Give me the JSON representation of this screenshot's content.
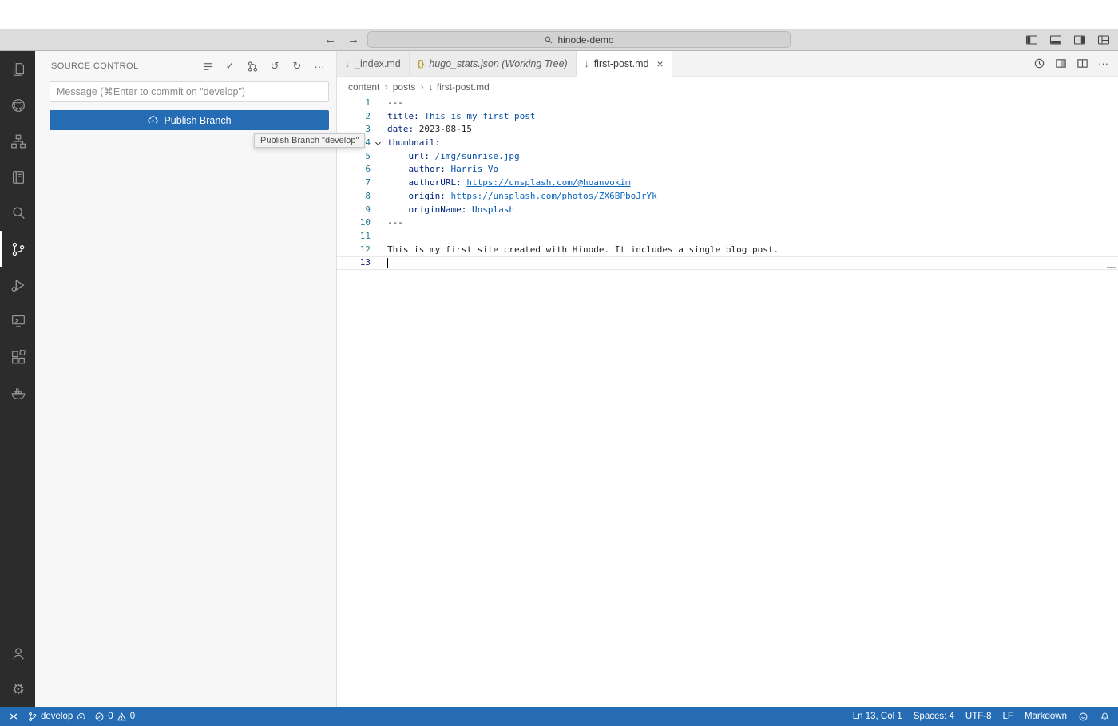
{
  "title_bar": {
    "search_value": "hinode-demo"
  },
  "icons": {
    "back": "←",
    "forward": "→",
    "check": "✓",
    "history": "↺",
    "refresh": "↻",
    "more": "···",
    "gear": "⚙",
    "markdown": "↓",
    "json": "{}",
    "close": "×",
    "sep": "›"
  },
  "sidebar": {
    "title": "SOURCE CONTROL",
    "message_placeholder": "Message (⌘Enter to commit on \"develop\")",
    "publish_label": "Publish Branch",
    "tooltip": "Publish Branch \"develop\""
  },
  "editor": {
    "tabs": [
      {
        "label": "_index.md"
      },
      {
        "label": "hugo_stats.json (Working Tree)"
      },
      {
        "label": "first-post.md"
      }
    ],
    "breadcrumb": {
      "0": "content",
      "1": "posts",
      "2": "first-post.md"
    },
    "lines": [
      {
        "n": 1,
        "tokens": [
          {
            "t": "---",
            "c": "p"
          }
        ]
      },
      {
        "n": 2,
        "tokens": [
          {
            "t": "title: ",
            "c": "k"
          },
          {
            "t": "This is my first post",
            "c": "v"
          }
        ]
      },
      {
        "n": 3,
        "tokens": [
          {
            "t": "date: ",
            "c": "k"
          },
          {
            "t": "2023-08-15",
            "c": "p"
          }
        ]
      },
      {
        "n": 4,
        "fold": true,
        "tokens": [
          {
            "t": "thumbnail:",
            "c": "k"
          }
        ]
      },
      {
        "n": 5,
        "tokens": [
          {
            "t": "    ",
            "c": "p"
          },
          {
            "t": "url: ",
            "c": "k"
          },
          {
            "t": "/img/sunrise.jpg",
            "c": "v"
          }
        ]
      },
      {
        "n": 6,
        "tokens": [
          {
            "t": "    ",
            "c": "p"
          },
          {
            "t": "author: ",
            "c": "k"
          },
          {
            "t": "Harris Vo",
            "c": "v"
          }
        ]
      },
      {
        "n": 7,
        "tokens": [
          {
            "t": "    ",
            "c": "p"
          },
          {
            "t": "authorURL: ",
            "c": "k"
          },
          {
            "t": "https://unsplash.com/@hoanvokim",
            "c": "l"
          }
        ]
      },
      {
        "n": 8,
        "tokens": [
          {
            "t": "    ",
            "c": "p"
          },
          {
            "t": "origin: ",
            "c": "k"
          },
          {
            "t": "https://unsplash.com/photos/ZX6BPboJrYk",
            "c": "l"
          }
        ]
      },
      {
        "n": 9,
        "tokens": [
          {
            "t": "    ",
            "c": "p"
          },
          {
            "t": "originName: ",
            "c": "k"
          },
          {
            "t": "Unsplash",
            "c": "v"
          }
        ]
      },
      {
        "n": 10,
        "tokens": [
          {
            "t": "---",
            "c": "p"
          }
        ]
      },
      {
        "n": 11,
        "tokens": []
      },
      {
        "n": 12,
        "tokens": [
          {
            "t": "This is my first site created with Hinode. It includes a single blog post.",
            "c": "p"
          }
        ]
      },
      {
        "n": 13,
        "active": true,
        "cursor": true,
        "tokens": []
      }
    ]
  },
  "status_bar": {
    "branch": "develop",
    "errors": "0",
    "warnings": "0",
    "line_col": "Ln 13, Col 1",
    "spaces": "Spaces: 4",
    "encoding": "UTF-8",
    "eol": "LF",
    "language": "Markdown"
  },
  "colors": {
    "accent": "#266cb4",
    "activity_bar": "#2c2c2c",
    "link": "#0a66c2"
  }
}
